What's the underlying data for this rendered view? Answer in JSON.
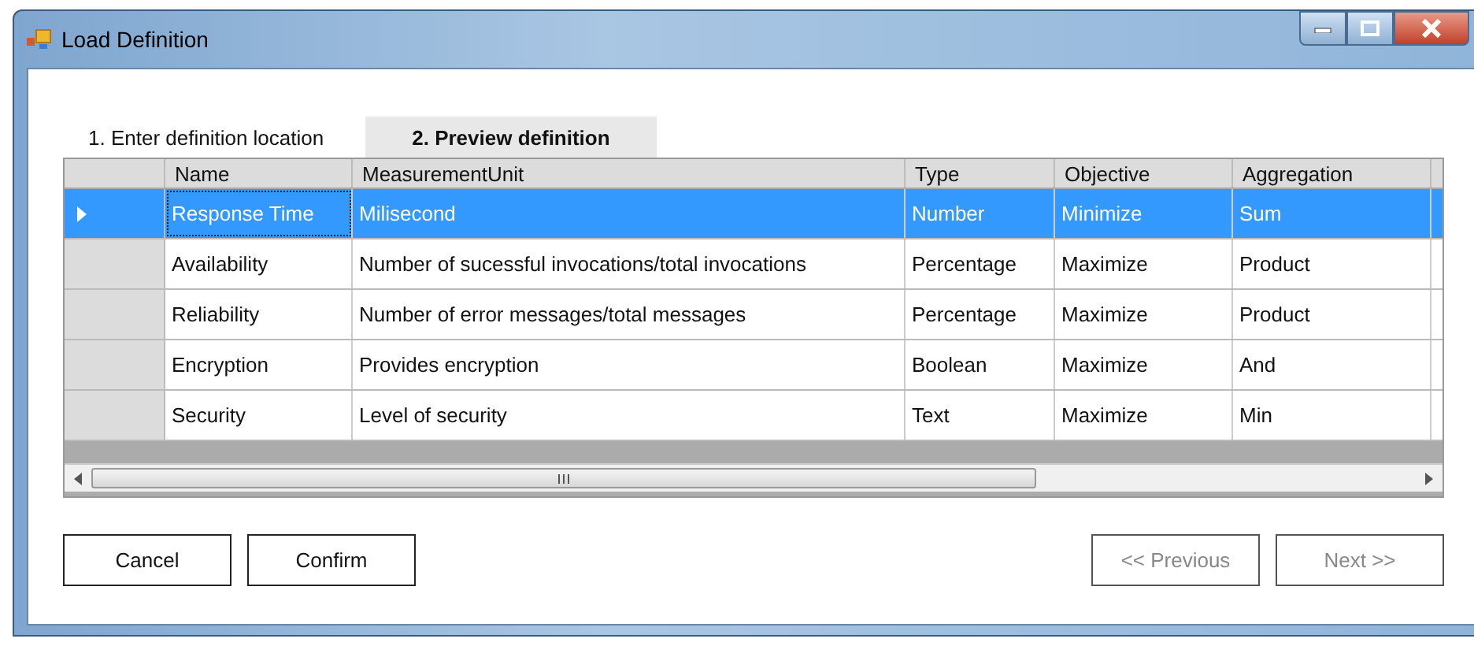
{
  "window": {
    "title": "Load Definition"
  },
  "tabs": [
    {
      "label": "1. Enter definition location",
      "selected": false
    },
    {
      "label": "2. Preview definition",
      "selected": true
    }
  ],
  "table": {
    "columns": [
      "Name",
      "MeasurementUnit",
      "Type",
      "Objective",
      "Aggregation"
    ],
    "rows": [
      {
        "selected": true,
        "cells": [
          "Response Time",
          "Milisecond",
          "Number",
          "Minimize",
          "Sum"
        ]
      },
      {
        "selected": false,
        "cells": [
          "Availability",
          "Number of sucessful invocations/total invocations",
          "Percentage",
          "Maximize",
          "Product"
        ]
      },
      {
        "selected": false,
        "cells": [
          "Reliability",
          "Number of error messages/total messages",
          "Percentage",
          "Maximize",
          "Product"
        ]
      },
      {
        "selected": false,
        "cells": [
          "Encryption",
          "Provides encryption",
          "Boolean",
          "Maximize",
          "And"
        ]
      },
      {
        "selected": false,
        "cells": [
          "Security",
          "Level of security",
          "Text",
          "Maximize",
          "Min"
        ]
      }
    ]
  },
  "buttons_left": [
    {
      "label": "Cancel",
      "disabled": false
    },
    {
      "label": "Confirm",
      "disabled": false
    }
  ],
  "buttons_right": [
    {
      "label": "<< Previous",
      "disabled": true
    },
    {
      "label": "Next >>",
      "disabled": true
    }
  ]
}
